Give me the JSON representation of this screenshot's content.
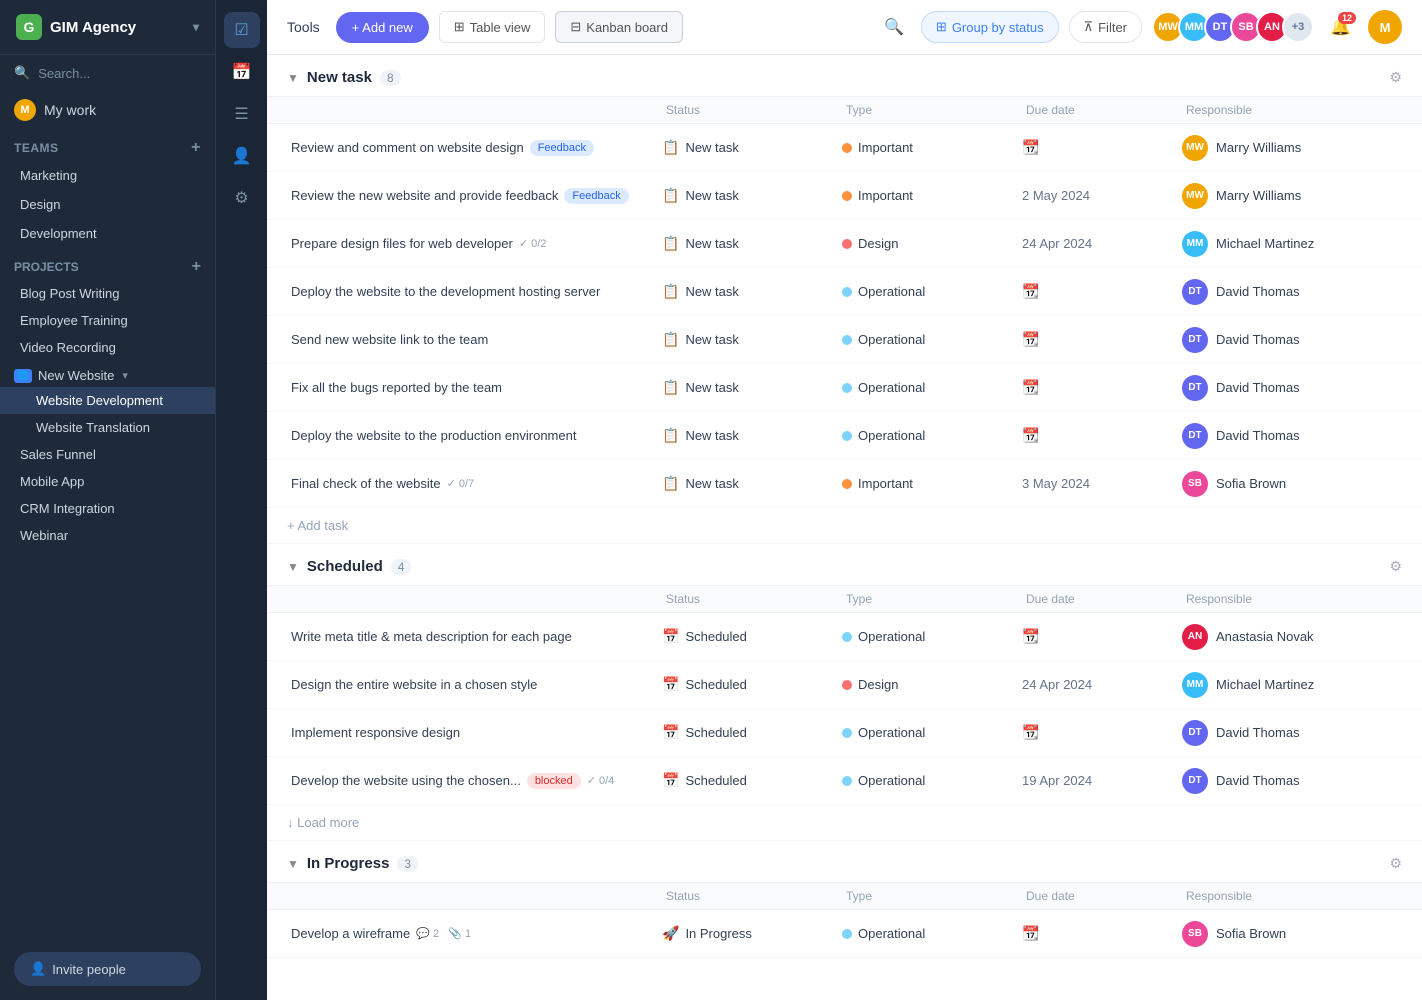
{
  "app": {
    "name": "GIM Agency",
    "logo_letter": "G"
  },
  "sidebar": {
    "search_placeholder": "Search...",
    "my_work_label": "My work",
    "teams_label": "Teams",
    "projects_label": "Projects",
    "teams": [
      {
        "label": "Marketing"
      },
      {
        "label": "Design"
      },
      {
        "label": "Development"
      }
    ],
    "projects": [
      {
        "label": "Blog Post Writing"
      },
      {
        "label": "Employee Training"
      },
      {
        "label": "Video Recording"
      },
      {
        "label": "New Website"
      },
      {
        "label": "Website Development"
      },
      {
        "label": "Website Translation"
      },
      {
        "label": "Sales Funnel"
      },
      {
        "label": "Mobile App"
      },
      {
        "label": "CRM Integration"
      },
      {
        "label": "Webinar"
      }
    ],
    "invite_label": "Invite people"
  },
  "toolbar": {
    "tools_label": "Tools",
    "add_new_label": "+ Add new",
    "table_view_label": "Table view",
    "kanban_board_label": "Kanban board",
    "group_by_label": "Group by status",
    "filter_label": "Filter",
    "notification_count": "12"
  },
  "task_groups": [
    {
      "title": "New task",
      "count": "8",
      "col_headers": [
        "Status",
        "Type",
        "Due date",
        "Responsible"
      ],
      "tasks": [
        {
          "name": "Review and comment on website design",
          "tag": "Feedback",
          "tag_type": "feedback",
          "status_icon": "📋",
          "status": "New task",
          "type_color": "#fb923c",
          "type": "Important",
          "due_date": "",
          "responsible_name": "Marry Williams",
          "responsible_color": "#f0a500"
        },
        {
          "name": "Review the new website and provide feedback",
          "tag": "Feedback",
          "tag_type": "feedback",
          "status_icon": "📋",
          "status": "New task",
          "type_color": "#fb923c",
          "type": "Important",
          "due_date": "2 May 2024",
          "responsible_name": "Marry Williams",
          "responsible_color": "#f0a500"
        },
        {
          "name": "Prepare design files for web developer",
          "tag": "",
          "check_count": "0/2",
          "status_icon": "📋",
          "status": "New task",
          "type_color": "#f87171",
          "type": "Design",
          "due_date": "24 Apr 2024",
          "responsible_name": "Michael Martinez",
          "responsible_color": "#38bdf8"
        },
        {
          "name": "Deploy the website to the development hosting server",
          "tag": "",
          "status_icon": "📋",
          "status": "New task",
          "type_color": "#7dd3fc",
          "type": "Operational",
          "due_date": "",
          "responsible_name": "David Thomas",
          "responsible_color": "#6366f1"
        },
        {
          "name": "Send new website link to the team",
          "tag": "",
          "status_icon": "📋",
          "status": "New task",
          "type_color": "#7dd3fc",
          "type": "Operational",
          "due_date": "",
          "responsible_name": "David Thomas",
          "responsible_color": "#6366f1"
        },
        {
          "name": "Fix all the bugs reported by the team",
          "tag": "",
          "status_icon": "📋",
          "status": "New task",
          "type_color": "#7dd3fc",
          "type": "Operational",
          "due_date": "",
          "responsible_name": "David Thomas",
          "responsible_color": "#6366f1"
        },
        {
          "name": "Deploy the website to the production environment",
          "tag": "",
          "status_icon": "📋",
          "status": "New task",
          "type_color": "#7dd3fc",
          "type": "Operational",
          "due_date": "",
          "responsible_name": "David Thomas",
          "responsible_color": "#6366f1"
        },
        {
          "name": "Final check of the website",
          "tag": "",
          "check_count": "0/7",
          "status_icon": "📋",
          "status": "New task",
          "type_color": "#fb923c",
          "type": "Important",
          "due_date": "3 May 2024",
          "responsible_name": "Sofia Brown",
          "responsible_color": "#ec4899"
        }
      ],
      "add_task_label": "+ Add task"
    },
    {
      "title": "Scheduled",
      "count": "4",
      "col_headers": [
        "Status",
        "Type",
        "Due date",
        "Responsible"
      ],
      "tasks": [
        {
          "name": "Write meta title & meta description for each page",
          "tag": "",
          "status_icon": "📅",
          "status": "Scheduled",
          "type_color": "#7dd3fc",
          "type": "Operational",
          "due_date": "",
          "responsible_name": "Anastasia Novak",
          "responsible_color": "#e11d48"
        },
        {
          "name": "Design the entire website in a chosen style",
          "tag": "",
          "status_icon": "📅",
          "status": "Scheduled",
          "type_color": "#f87171",
          "type": "Design",
          "due_date": "24 Apr 2024",
          "responsible_name": "Michael Martinez",
          "responsible_color": "#38bdf8"
        },
        {
          "name": "Implement responsive design",
          "tag": "",
          "status_icon": "📅",
          "status": "Scheduled",
          "type_color": "#7dd3fc",
          "type": "Operational",
          "due_date": "",
          "responsible_name": "David Thomas",
          "responsible_color": "#6366f1"
        },
        {
          "name": "Develop the website using the chosen...",
          "tag": "blocked",
          "tag_type": "blocked",
          "check_count": "0/4",
          "status_icon": "📅",
          "status": "Scheduled",
          "type_color": "#7dd3fc",
          "type": "Operational",
          "due_date": "19 Apr 2024",
          "responsible_name": "David Thomas",
          "responsible_color": "#6366f1"
        }
      ],
      "load_more_label": "↓ Load more"
    },
    {
      "title": "In Progress",
      "count": "3",
      "col_headers": [
        "Status",
        "Type",
        "Due date",
        "Responsible"
      ],
      "tasks": [
        {
          "name": "Develop a wireframe",
          "tag": "",
          "comment_count": "2",
          "attachment_count": "1",
          "status_icon": "🚀",
          "status": "In Progress",
          "type_color": "#7dd3fc",
          "type": "Operational",
          "due_date": "",
          "responsible_name": "Sofia Brown",
          "responsible_color": "#ec4899"
        }
      ]
    }
  ],
  "avatars": [
    {
      "color": "#f0a500",
      "initials": "MW"
    },
    {
      "color": "#38bdf8",
      "initials": "MM"
    },
    {
      "color": "#6366f1",
      "initials": "DT"
    },
    {
      "color": "#ec4899",
      "initials": "SB"
    },
    {
      "color": "#e11d48",
      "initials": "AN"
    }
  ],
  "avatar_extra": "+3"
}
